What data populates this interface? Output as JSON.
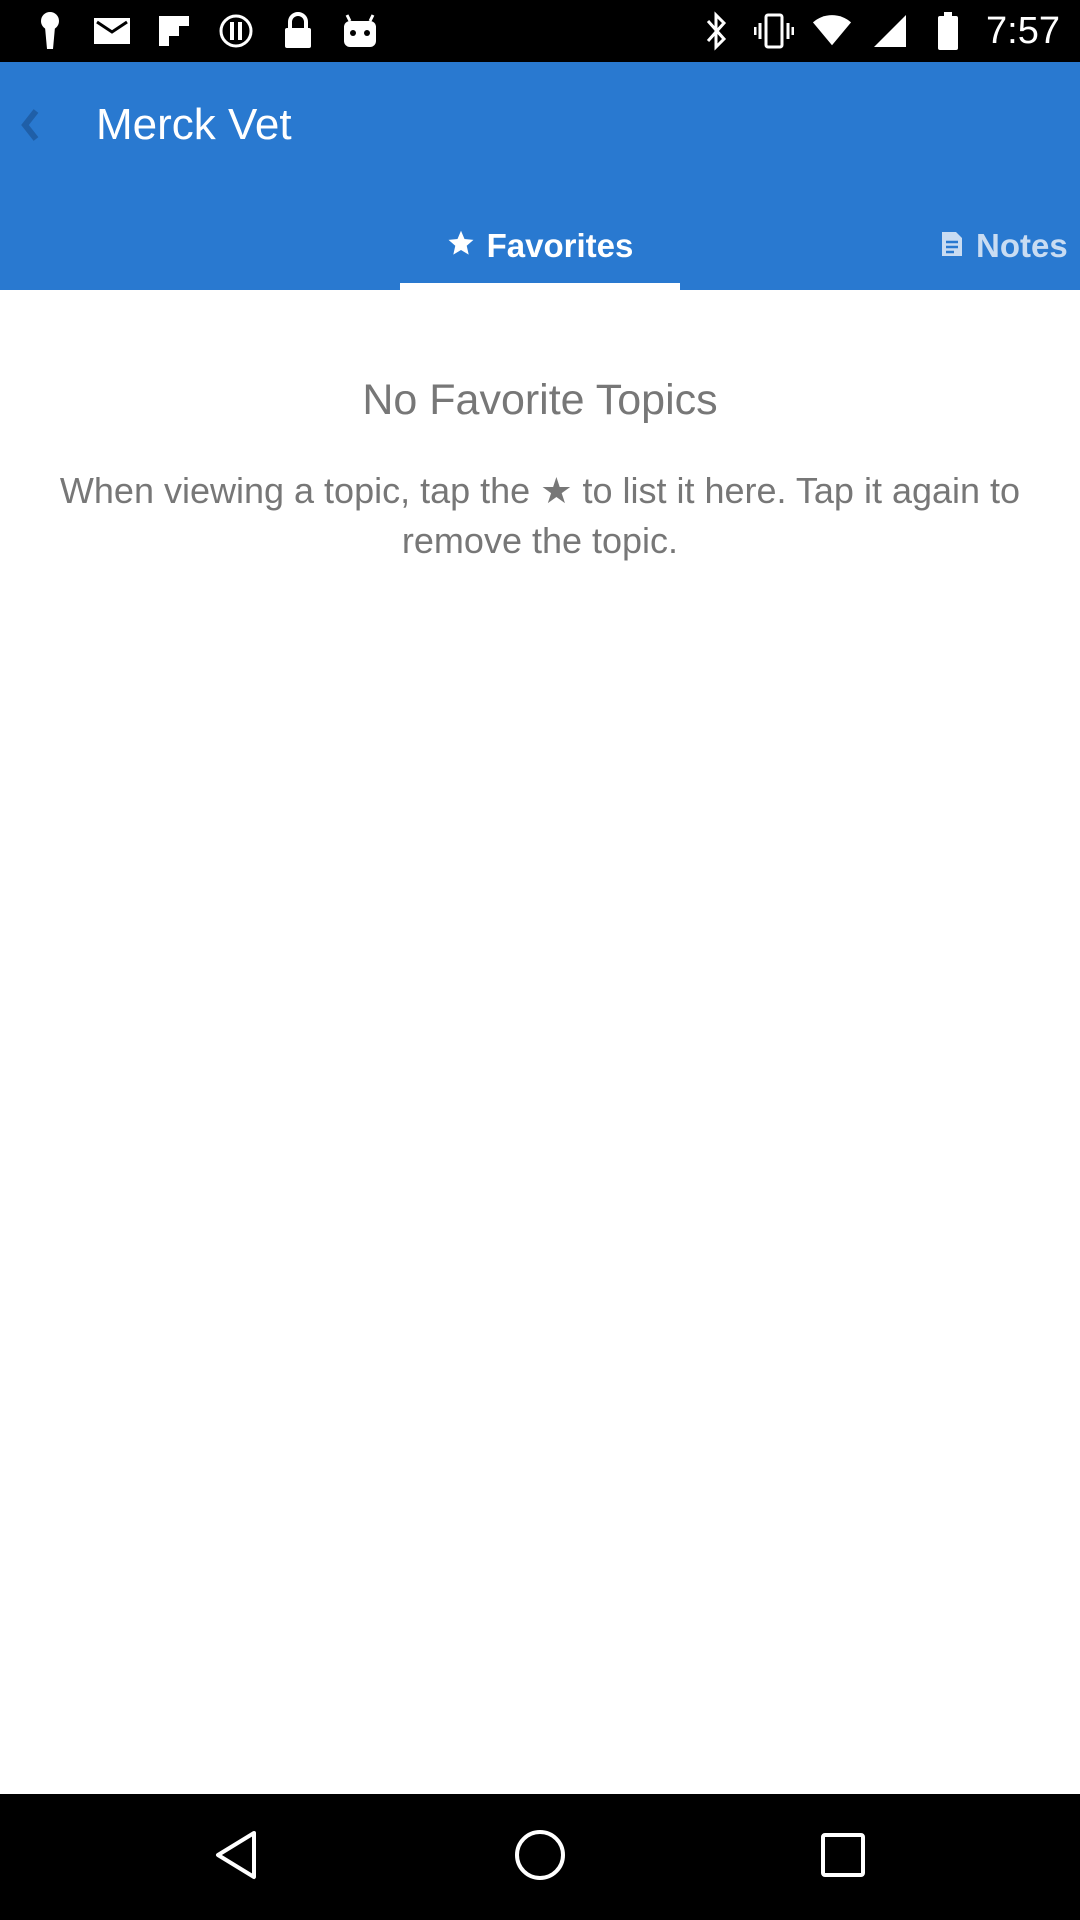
{
  "status_bar": {
    "time": "7:57",
    "left_icons": [
      "keyhole-icon",
      "email-icon",
      "flipboard-icon",
      "alert-icon",
      "lock-icon",
      "android-icon"
    ],
    "right_icons": [
      "bluetooth-icon",
      "vibrate-icon",
      "wifi-icon",
      "signal-icon",
      "battery-icon"
    ]
  },
  "app_bar": {
    "title": "Merck Vet",
    "color": "#2979d0"
  },
  "tabs": [
    {
      "label": "Favorites",
      "icon": "star-icon",
      "selected": true
    },
    {
      "label": "Notes",
      "icon": "note-icon",
      "selected": false
    }
  ],
  "empty_state": {
    "title": "No Favorite Topics",
    "description": "When viewing a topic, tap the ★ to list it here. Tap it again to remove the topic."
  },
  "nav_bar": {
    "buttons": [
      "back-triangle-icon",
      "home-circle-icon",
      "recents-square-icon"
    ]
  }
}
